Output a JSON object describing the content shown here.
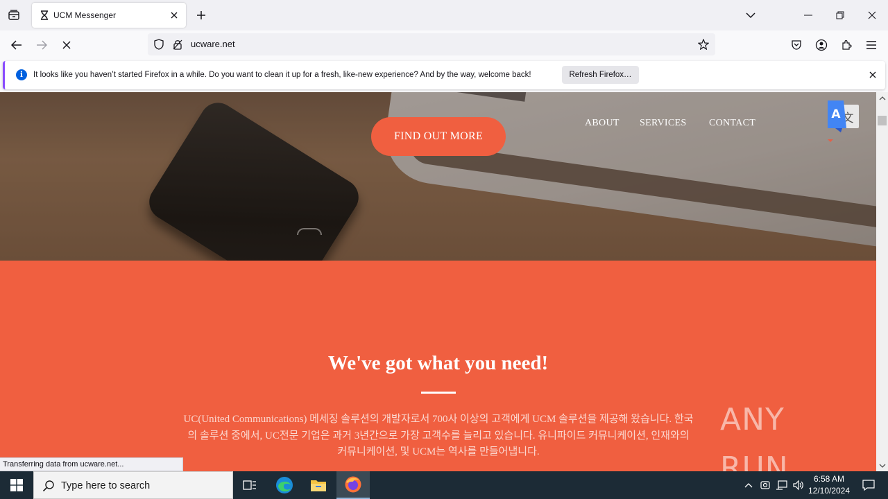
{
  "browser": {
    "tab": {
      "title": "UCM Messenger"
    },
    "url": "ucware.net",
    "notification": {
      "message": "It looks like you haven’t started Firefox in a while. Do you want to clean it up for a fresh, like-new experience? And by the way, welcome back!",
      "button_label": "Refresh Firefox…"
    },
    "status_text": "Transferring data from ucware.net..."
  },
  "page": {
    "cta_label": "FIND OUT MORE",
    "nav": [
      "ABOUT",
      "SERVICES",
      "CONTACT"
    ],
    "section": {
      "title": "We've got what you need!",
      "body": "UC(United Communications) 메세징 솔루션의 개발자로서 700사 이상의 고객에게 UCM 솔루션을 제공해 왔습니다. 한국의 솔루션 중에서, UC전문 기업은 과거 3년간으로 가장 고객수를 늘리고 있습니다. 유니파이드 커뮤니케이션, 인재와의 커뮤니케이션, 및 UCM는 역사를 만들어냅니다."
    },
    "accent_color": "#f05f40"
  },
  "watermark": "ANY RUN",
  "taskbar": {
    "search_placeholder": "Type here to search",
    "time": "6:58 AM",
    "date": "12/10/2024"
  }
}
